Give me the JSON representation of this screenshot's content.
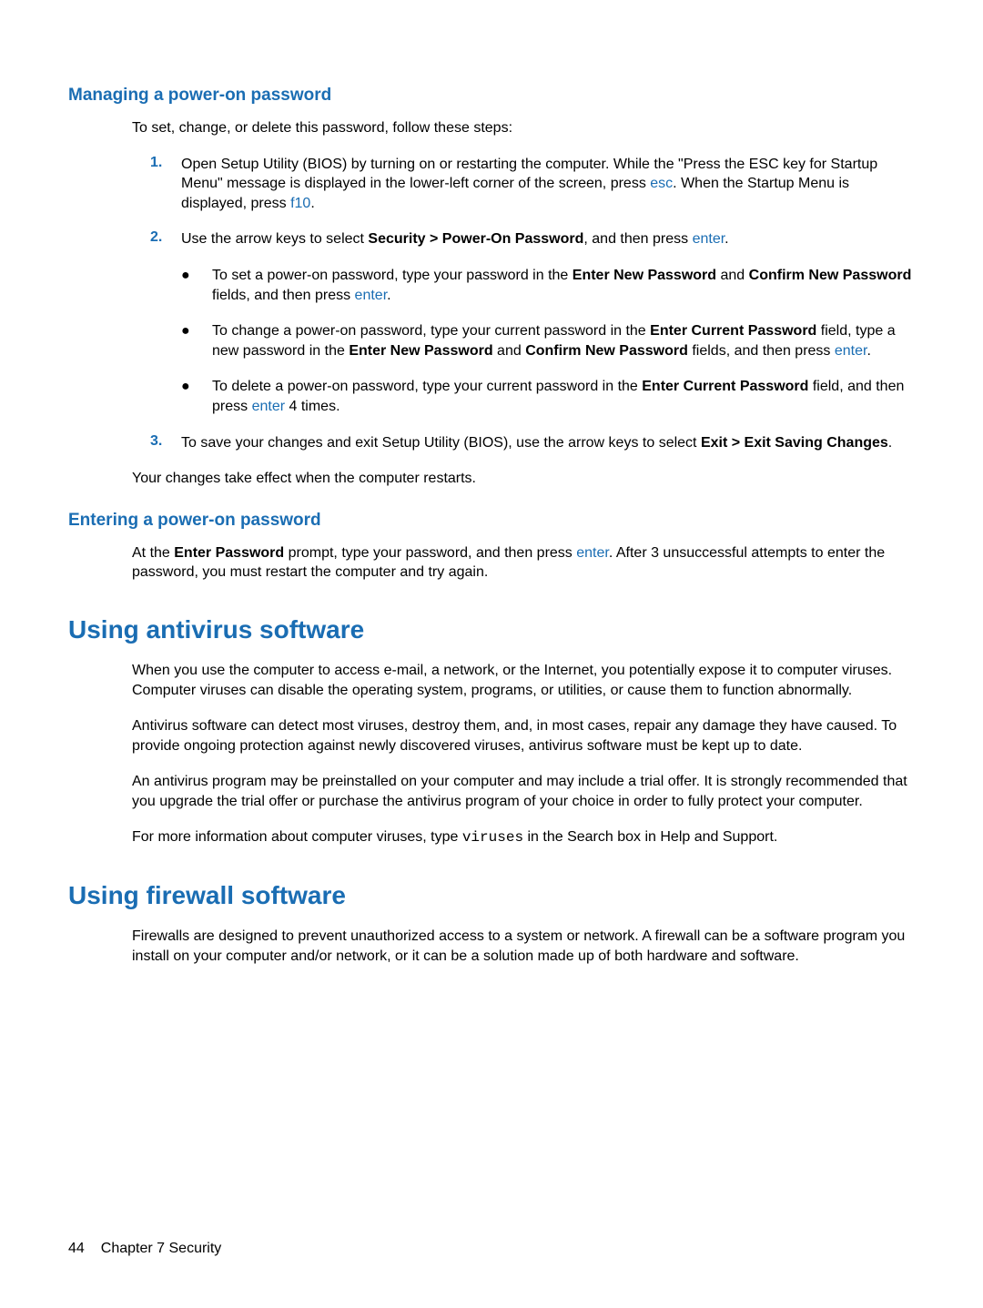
{
  "section1": {
    "heading": "Managing a power-on password",
    "intro": "To set, change, or delete this password, follow these steps:",
    "step1_a": "Open Setup Utility (BIOS) by turning on or restarting the computer. While the \"Press the ESC key for Startup Menu\" message is displayed in the lower-left corner of the screen, press ",
    "key_esc": "esc",
    "step1_b": ". When the Startup Menu is displayed, press ",
    "key_f10": "f10",
    "step1_c": ".",
    "step2_a": "Use the arrow keys to select ",
    "step2_bold": "Security > Power-On Password",
    "step2_b": ", and then press ",
    "key_enter": "enter",
    "step2_c": ".",
    "bullet1_a": "To set a power-on password, type your password in the ",
    "bullet1_bold1": "Enter New Password",
    "bullet1_b": " and ",
    "bullet1_bold2": "Confirm New Password",
    "bullet1_c": " fields, and then press ",
    "bullet1_d": ".",
    "bullet2_a": "To change a power-on password, type your current password in the ",
    "bullet2_bold1": "Enter Current Password",
    "bullet2_b": " field, type a new password in the ",
    "bullet2_bold2": "Enter New Password",
    "bullet2_c": " and ",
    "bullet2_bold3": "Confirm New Password",
    "bullet2_d": " fields, and then press ",
    "bullet2_e": ".",
    "bullet3_a": "To delete a power-on password, type your current password in the ",
    "bullet3_bold1": "Enter Current Password",
    "bullet3_b": " field, and then press ",
    "bullet3_c": " 4 times.",
    "step3_a": "To save your changes and exit Setup Utility (BIOS), use the arrow keys to select ",
    "step3_bold": "Exit > Exit Saving Changes",
    "step3_b": ".",
    "outro": "Your changes take effect when the computer restarts."
  },
  "section2": {
    "heading": "Entering a power-on password",
    "p1_a": "At the ",
    "p1_bold": "Enter Password",
    "p1_b": " prompt, type your password, and then press ",
    "p1_c": ". After 3 unsuccessful attempts to enter the password, you must restart the computer and try again."
  },
  "section3": {
    "heading": "Using antivirus software",
    "p1": "When you use the computer to access e-mail, a network, or the Internet, you potentially expose it to computer viruses. Computer viruses can disable the operating system, programs, or utilities, or cause them to function abnormally.",
    "p2": "Antivirus software can detect most viruses, destroy them, and, in most cases, repair any damage they have caused. To provide ongoing protection against newly discovered viruses, antivirus software must be kept up to date.",
    "p3": "An antivirus program may be preinstalled on your computer and may include a trial offer. It is strongly recommended that you upgrade the trial offer or purchase the antivirus program of your choice in order to fully protect your computer.",
    "p4_a": "For more information about computer viruses, type ",
    "p4_mono": "viruses",
    "p4_b": " in the Search box in Help and Support."
  },
  "section4": {
    "heading": "Using firewall software",
    "p1": "Firewalls are designed to prevent unauthorized access to a system or network. A firewall can be a software program you install on your computer and/or network, or it can be a solution made up of both hardware and software."
  },
  "list": {
    "n1": "1.",
    "n2": "2.",
    "n3": "3.",
    "bullet": "●"
  },
  "footer": {
    "page": "44",
    "chapter": "Chapter 7   Security"
  }
}
